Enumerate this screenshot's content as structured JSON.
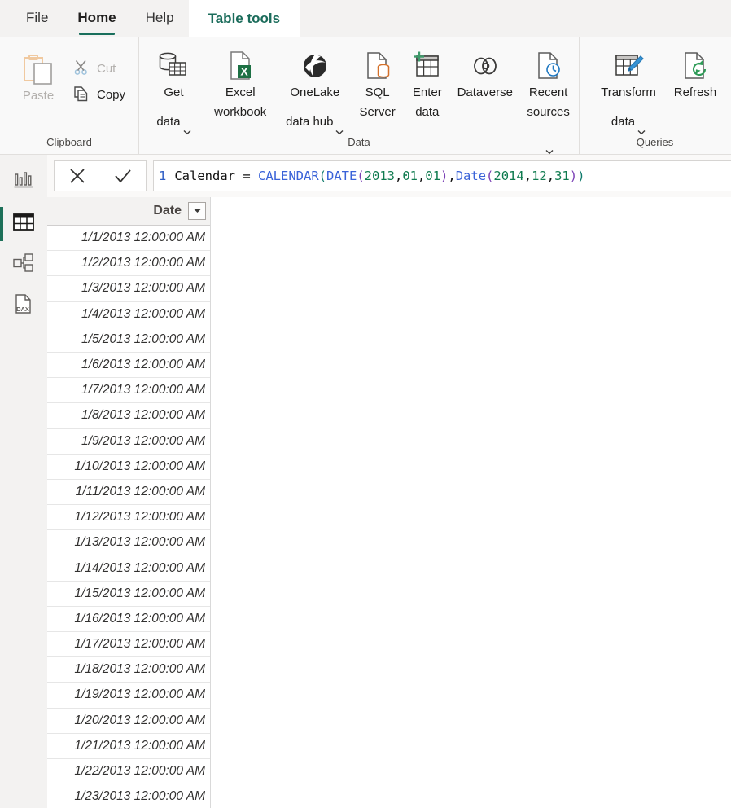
{
  "window": {
    "app": "Power BI Desktop"
  },
  "ribbon": {
    "tabs": [
      {
        "label": "File",
        "state": "normal"
      },
      {
        "label": "Home",
        "state": "active"
      },
      {
        "label": "Help",
        "state": "normal"
      },
      {
        "label": "Table tools",
        "state": "contextual"
      }
    ],
    "accent_color": "#196f5c",
    "contextual_color": "#1b6c5b",
    "groups": [
      {
        "name": "clipboard",
        "label": "Clipboard",
        "buttons": [
          {
            "id": "paste",
            "label": "Paste",
            "icon": "paste-icon",
            "enabled": false,
            "size": "large"
          },
          {
            "id": "cut",
            "label": "Cut",
            "icon": "scissors-icon",
            "enabled": false,
            "size": "small"
          },
          {
            "id": "copy",
            "label": "Copy",
            "icon": "copy-icon",
            "enabled": true,
            "size": "small"
          }
        ]
      },
      {
        "name": "data",
        "label": "Data",
        "buttons": [
          {
            "id": "get-data",
            "label": "Get\ndata",
            "icon": "database-table-icon",
            "enabled": true,
            "dropdown": true
          },
          {
            "id": "excel-workbook",
            "label": "Excel\nworkbook",
            "icon": "excel-file-icon",
            "enabled": true,
            "dropdown": false
          },
          {
            "id": "onelake-hub",
            "label": "OneLake\ndata hub",
            "icon": "onelake-icon",
            "enabled": true,
            "dropdown": true
          },
          {
            "id": "sql-server",
            "label": "SQL\nServer",
            "icon": "sql-server-icon",
            "enabled": true,
            "dropdown": false
          },
          {
            "id": "enter-data",
            "label": "Enter\ndata",
            "icon": "enter-data-icon",
            "enabled": true,
            "dropdown": false
          },
          {
            "id": "dataverse",
            "label": "Dataverse",
            "icon": "dataverse-icon",
            "enabled": true,
            "dropdown": false
          },
          {
            "id": "recent-sources",
            "label": "Recent\nsources",
            "icon": "recent-sources-icon",
            "enabled": true,
            "dropdown": true
          }
        ]
      },
      {
        "name": "queries",
        "label": "Queries",
        "buttons": [
          {
            "id": "transform-data",
            "label": "Transform\ndata",
            "icon": "transform-data-icon",
            "enabled": true,
            "dropdown": true
          },
          {
            "id": "refresh",
            "label": "Refresh",
            "icon": "refresh-icon",
            "enabled": true,
            "dropdown": false
          }
        ]
      }
    ]
  },
  "rail": {
    "items": [
      {
        "id": "report",
        "icon": "report-bar-chart-icon",
        "selected": false
      },
      {
        "id": "table",
        "icon": "table-grid-icon",
        "selected": true
      },
      {
        "id": "model",
        "icon": "model-relationship-icon",
        "selected": false
      },
      {
        "id": "dax-query",
        "icon": "dax-query-icon",
        "selected": false
      }
    ],
    "selected_indicator_color": "#1d7059"
  },
  "formula_bar": {
    "cancel_label": "✕",
    "commit_label": "✓",
    "line_number": "1",
    "formula_text": "Calendar = CALENDAR(DATE(2013,01,01),Date(2014,12,31))",
    "tokens": [
      {
        "t": "Calendar = ",
        "c": "plain"
      },
      {
        "t": "CALENDAR",
        "c": "fn"
      },
      {
        "t": "(",
        "c": "p1"
      },
      {
        "t": "DATE",
        "c": "fn"
      },
      {
        "t": "(",
        "c": "p2"
      },
      {
        "t": "2013",
        "c": "num"
      },
      {
        "t": ",",
        "c": "plain"
      },
      {
        "t": "01",
        "c": "num"
      },
      {
        "t": ",",
        "c": "plain"
      },
      {
        "t": "01",
        "c": "num"
      },
      {
        "t": ")",
        "c": "p2"
      },
      {
        "t": ",",
        "c": "plain"
      },
      {
        "t": "Date",
        "c": "fn"
      },
      {
        "t": "(",
        "c": "p2"
      },
      {
        "t": "2014",
        "c": "num"
      },
      {
        "t": ",",
        "c": "plain"
      },
      {
        "t": "12",
        "c": "num"
      },
      {
        "t": ",",
        "c": "plain"
      },
      {
        "t": "31",
        "c": "num"
      },
      {
        "t": ")",
        "c": "p2"
      },
      {
        "t": ")",
        "c": "p1"
      }
    ]
  },
  "table": {
    "column_header": "Date",
    "filter_icon": "filter-dropdown-icon",
    "rows": [
      "1/1/2013 12:00:00 AM",
      "1/2/2013 12:00:00 AM",
      "1/3/2013 12:00:00 AM",
      "1/4/2013 12:00:00 AM",
      "1/5/2013 12:00:00 AM",
      "1/6/2013 12:00:00 AM",
      "1/7/2013 12:00:00 AM",
      "1/8/2013 12:00:00 AM",
      "1/9/2013 12:00:00 AM",
      "1/10/2013 12:00:00 AM",
      "1/11/2013 12:00:00 AM",
      "1/12/2013 12:00:00 AM",
      "1/13/2013 12:00:00 AM",
      "1/14/2013 12:00:00 AM",
      "1/15/2013 12:00:00 AM",
      "1/16/2013 12:00:00 AM",
      "1/17/2013 12:00:00 AM",
      "1/18/2013 12:00:00 AM",
      "1/19/2013 12:00:00 AM",
      "1/20/2013 12:00:00 AM",
      "1/21/2013 12:00:00 AM",
      "1/22/2013 12:00:00 AM",
      "1/23/2013 12:00:00 AM"
    ]
  }
}
